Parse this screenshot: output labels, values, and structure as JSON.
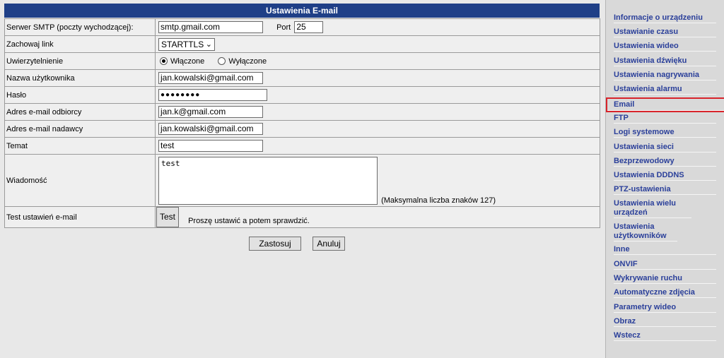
{
  "header": {
    "title": "Ustawienia E-mail"
  },
  "form": {
    "smtp_label": "Serwer SMTP (poczty wychodzącej):",
    "smtp_value": "smtp.gmail.com",
    "port_label": "Port",
    "port_value": "25",
    "secure_label": "Zachowaj link",
    "secure_value": "STARTTLS",
    "auth_label": "Uwierzytelnienie",
    "auth_on": "Włączone",
    "auth_off": "Wyłączone",
    "user_label": "Nazwa użytkownika",
    "user_value": "jan.kowalski@gmail.com",
    "pass_label": "Hasło",
    "pass_value": "●●●●●●●●",
    "to_label": "Adres e-mail odbiorcy",
    "to_value": "jan.k@gmail.com",
    "from_label": "Adres e-mail nadawcy",
    "from_value": "jan.kowalski@gmail.com",
    "subject_label": "Temat",
    "subject_value": "test",
    "message_label": "Wiadomość",
    "message_value": "test",
    "max_chars": "(Maksymalna liczba znaków 127)",
    "test_label": "Test ustawień e-mail",
    "test_button": "Test",
    "test_hint": "Proszę ustawić a potem sprawdzić."
  },
  "actions": {
    "apply": "Zastosuj",
    "cancel": "Anuluj"
  },
  "sidebar": {
    "items": [
      {
        "label": "Informacje o urządzeniu"
      },
      {
        "label": "Ustawianie czasu"
      },
      {
        "label": "Ustawienia wideo"
      },
      {
        "label": "Ustawienia dźwięku"
      },
      {
        "label": "Ustawienia nagrywania"
      },
      {
        "label": "Ustawienia alarmu"
      },
      {
        "label": "Email"
      },
      {
        "label": "FTP"
      },
      {
        "label": "Logi systemowe"
      },
      {
        "label": "Ustawienia sieci"
      },
      {
        "label": "Bezprzewodowy"
      },
      {
        "label": "Ustawienia DDDNS"
      },
      {
        "label": "PTZ-ustawienia"
      },
      {
        "label": "Ustawienia wielu urządzeń"
      },
      {
        "label": "Ustawienia użytkowników"
      },
      {
        "label": "Inne"
      },
      {
        "label": "ONVIF"
      },
      {
        "label": "Wykrywanie ruchu"
      },
      {
        "label": "Automatyczne zdjęcia"
      },
      {
        "label": "Parametry wideo"
      },
      {
        "label": "Obraz"
      },
      {
        "label": "Wstecz"
      }
    ],
    "selected_index": 6,
    "selected_outline_color": "#d8242b"
  }
}
